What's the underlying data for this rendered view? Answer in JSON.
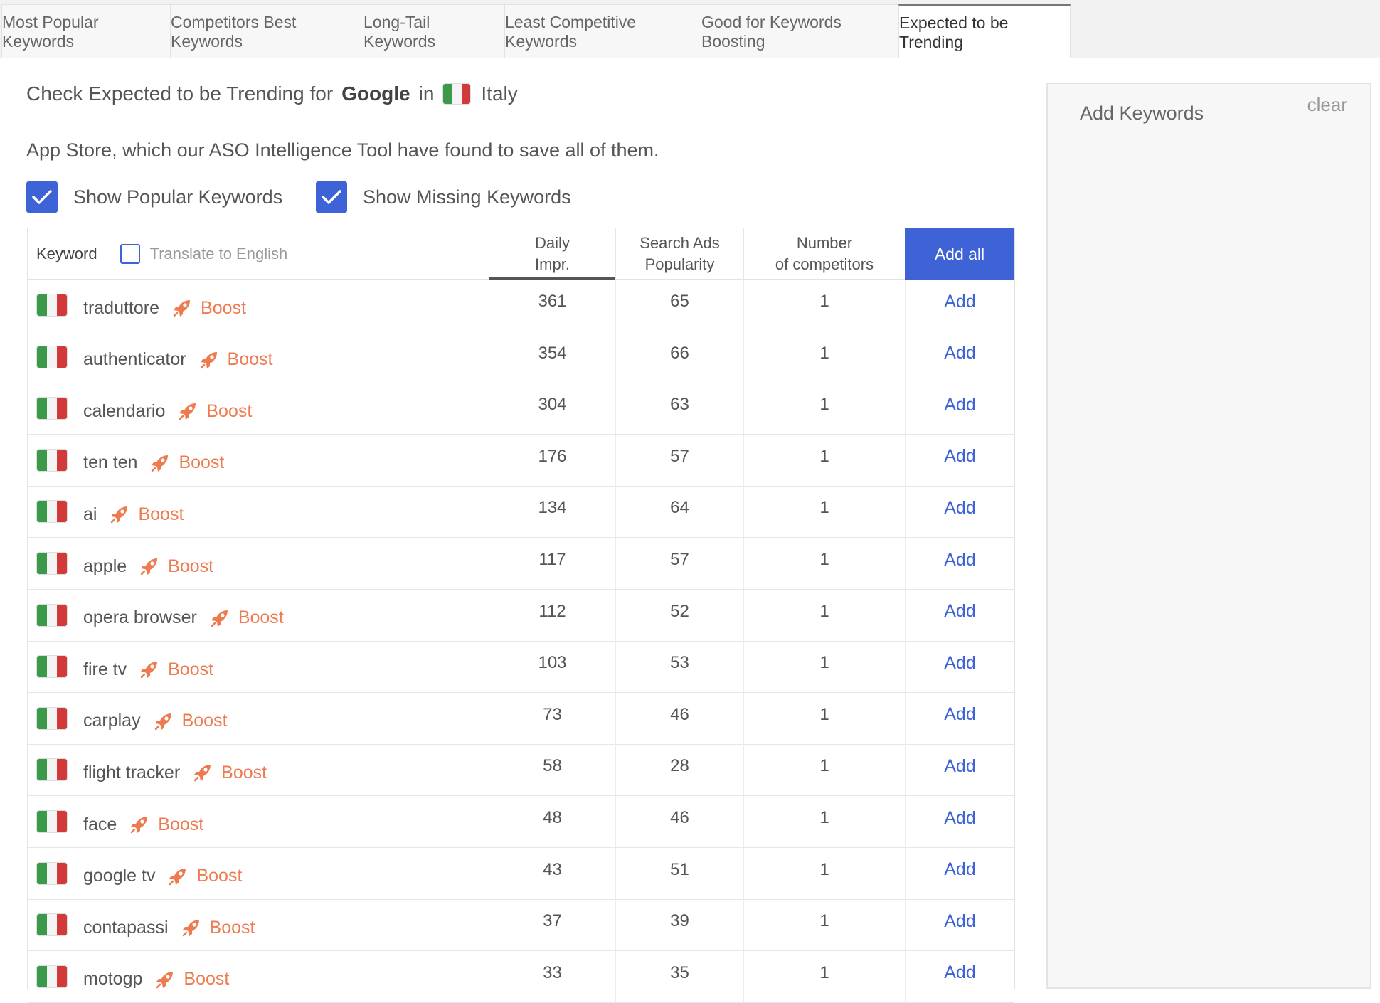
{
  "tabs": [
    {
      "label": "Most Popular Keywords",
      "active": false
    },
    {
      "label": "Competitors Best Keywords",
      "active": false
    },
    {
      "label": "Long-Tail Keywords",
      "active": false
    },
    {
      "label": "Least Competitive Keywords",
      "active": false
    },
    {
      "label": "Good for Keywords Boosting",
      "active": false
    },
    {
      "label": "Expected to be Trending",
      "active": true
    }
  ],
  "heading": {
    "prefix": "Check Expected to be Trending for",
    "store": "Google",
    "connector": "in",
    "country": "Italy",
    "flag_icon": "italy-flag-icon"
  },
  "description": "App Store, which our ASO Intelligence Tool have found to save all of them.",
  "filters": {
    "show_popular": {
      "label": "Show Popular Keywords",
      "checked": true
    },
    "show_missing": {
      "label": "Show Missing Keywords",
      "checked": true
    }
  },
  "table": {
    "headers": {
      "keyword": "Keyword",
      "translate": "Translate to English",
      "daily_line1": "Daily",
      "daily_line2": "Impr.",
      "search_line1": "Search Ads",
      "search_line2": "Popularity",
      "comp_line1": "Number",
      "comp_line2": "of competitors",
      "add_all": "Add all"
    },
    "boost_label": "Boost",
    "add_label": "Add",
    "rows": [
      {
        "keyword": "traduttore",
        "daily": "361",
        "popularity": "65",
        "competitors": "1"
      },
      {
        "keyword": "authenticator",
        "daily": "354",
        "popularity": "66",
        "competitors": "1"
      },
      {
        "keyword": "calendario",
        "daily": "304",
        "popularity": "63",
        "competitors": "1"
      },
      {
        "keyword": "ten ten",
        "daily": "176",
        "popularity": "57",
        "competitors": "1"
      },
      {
        "keyword": "ai",
        "daily": "134",
        "popularity": "64",
        "competitors": "1"
      },
      {
        "keyword": "apple",
        "daily": "117",
        "popularity": "57",
        "competitors": "1"
      },
      {
        "keyword": "opera browser",
        "daily": "112",
        "popularity": "52",
        "competitors": "1"
      },
      {
        "keyword": "fire tv",
        "daily": "103",
        "popularity": "53",
        "competitors": "1"
      },
      {
        "keyword": "carplay",
        "daily": "73",
        "popularity": "46",
        "competitors": "1"
      },
      {
        "keyword": "flight tracker",
        "daily": "58",
        "popularity": "28",
        "competitors": "1"
      },
      {
        "keyword": "face",
        "daily": "48",
        "popularity": "46",
        "competitors": "1"
      },
      {
        "keyword": "google tv",
        "daily": "43",
        "popularity": "51",
        "competitors": "1"
      },
      {
        "keyword": "contapassi",
        "daily": "37",
        "popularity": "39",
        "competitors": "1"
      },
      {
        "keyword": "motogp",
        "daily": "33",
        "popularity": "35",
        "competitors": "1"
      }
    ]
  },
  "panel": {
    "title": "Add Keywords",
    "clear": "clear"
  },
  "colors": {
    "accent": "#3d63d6",
    "boost": "#ee7b50",
    "flag_green": "#3a9a4a",
    "flag_red": "#d23a3a"
  }
}
